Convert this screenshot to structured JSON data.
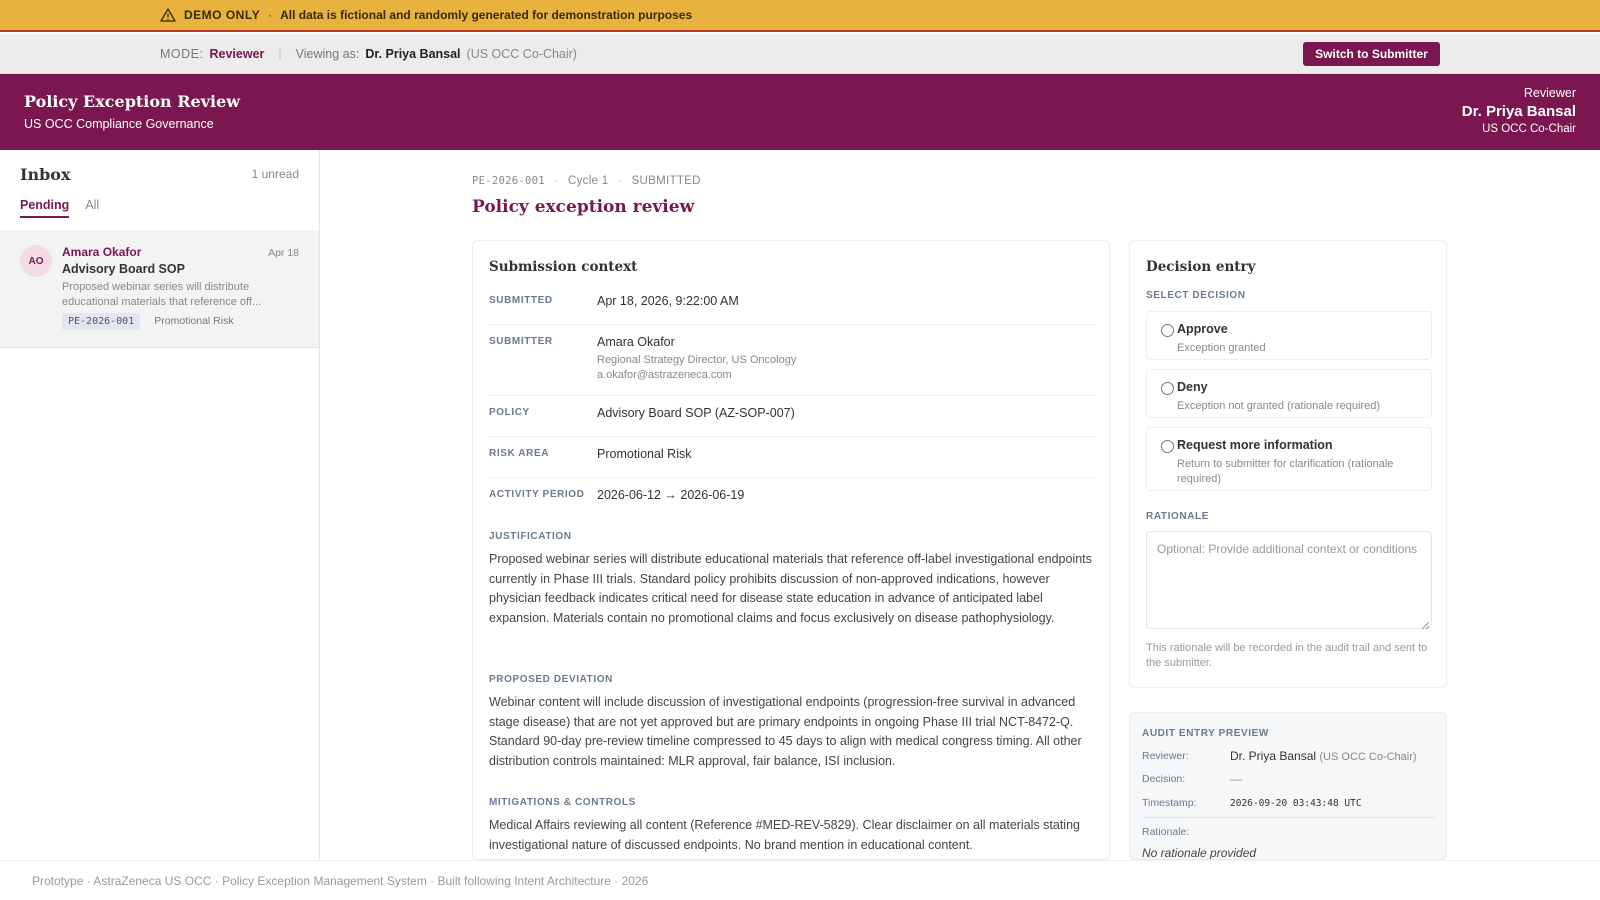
{
  "banner": {
    "icon": "warning-triangle-icon",
    "label": "DEMO ONLY",
    "separator": "·",
    "text": "All data is fictional and randomly generated for demonstration purposes"
  },
  "mode_bar": {
    "mode_label": "MODE:",
    "mode_value": "Reviewer",
    "divider": "|",
    "viewing_label": "Viewing as:",
    "viewing_name": "Dr. Priya Bansal",
    "viewing_role": "(US OCC Co-Chair)",
    "switch_button": "Switch to Submitter"
  },
  "header": {
    "title": "Policy Exception Review",
    "subtitle": "US OCC Compliance Governance",
    "user_role": "Reviewer",
    "user_name": "Dr. Priya Bansal",
    "user_title": "US OCC Co-Chair"
  },
  "inbox": {
    "title": "Inbox",
    "unread": "1 unread",
    "tabs": [
      "Pending",
      "All"
    ],
    "active_tab": "Pending",
    "items": [
      {
        "initials": "AO",
        "sender": "Amara Okafor",
        "date": "Apr 18",
        "subject": "Advisory Board SOP",
        "preview": "Proposed webinar series will distribute educational materials that reference off...",
        "id": "PE-2026-001",
        "risk": "Promotional Risk"
      }
    ]
  },
  "main": {
    "crumb_id": "PE-2026-001",
    "crumb_sep": "·",
    "crumb_cycle": "Cycle 1",
    "crumb_status": "SUBMITTED",
    "title": "Policy exception review"
  },
  "context": {
    "title": "Submission context",
    "fields": {
      "submitted": {
        "label": "SUBMITTED",
        "value": "Apr 18, 2026, 9:22:00 AM"
      },
      "submitter": {
        "label": "SUBMITTER",
        "value": "Amara Okafor",
        "sub1": "Regional Strategy Director, US Oncology",
        "sub2": "a.okafor@astrazeneca.com"
      },
      "policy": {
        "label": "POLICY",
        "value": "Advisory Board SOP (AZ-SOP-007)"
      },
      "risk_area": {
        "label": "RISK AREA",
        "value": "Promotional Risk"
      },
      "activity_period": {
        "label": "ACTIVITY PERIOD",
        "value": "2026-06-12 → 2026-06-19"
      }
    },
    "justification": {
      "label": "JUSTIFICATION",
      "text": "Proposed webinar series will distribute educational materials that reference off-label investigational endpoints currently in Phase III trials. Standard policy prohibits discussion of non-approved indications, however physician feedback indicates critical need for disease state education in advance of anticipated label expansion. Materials contain no promotional claims and focus exclusively on disease pathophysiology."
    },
    "deviation": {
      "label": "PROPOSED DEVIATION",
      "text": "Webinar content will include discussion of investigational endpoints (progression-free survival in advanced stage disease) that are not yet approved but are primary endpoints in ongoing Phase III trial NCT-8472-Q. Standard 90-day pre-review timeline compressed to 45 days to align with medical congress timing. All other distribution controls maintained: MLR approval, fair balance, ISI inclusion."
    },
    "mitigations": {
      "label": "MITIGATIONS & CONTROLS",
      "text": "Medical Affairs reviewing all content (Reference #MED-REV-5829). Clear disclaimer on all materials stating investigational nature of discussed endpoints. No brand mention in educational content."
    }
  },
  "decision": {
    "title": "Decision entry",
    "select_label": "SELECT DECISION",
    "options": [
      {
        "label": "Approve",
        "desc": "Exception granted"
      },
      {
        "label": "Deny",
        "desc": "Exception not granted (rationale required)"
      },
      {
        "label": "Request more information",
        "desc": "Return to submitter for clarification (rationale required)"
      }
    ],
    "rationale_label": "RATIONALE",
    "rationale_placeholder": "Optional: Provide additional context or conditions",
    "rationale_note": "This rationale will be recorded in the audit trail and sent to the submitter."
  },
  "audit": {
    "title": "AUDIT ENTRY PREVIEW",
    "reviewer_key": "Reviewer:",
    "reviewer_name": "Dr. Priya Bansal",
    "reviewer_role": "(US OCC Co-Chair)",
    "decision_key": "Decision:",
    "decision_value": "—",
    "timestamp_key": "Timestamp:",
    "timestamp_value": "2026-09-20 03:43:48 UTC",
    "rationale_key": "Rationale:",
    "rationale_value": "No rationale provided"
  },
  "footer": {
    "text": "Prototype · AstraZeneca US OCC · Policy Exception Management System · Built following Intent Architecture · 2026"
  },
  "colors": {
    "brand": "#7b1650",
    "banner": "#e8b23e",
    "label": "#6a7a90"
  }
}
